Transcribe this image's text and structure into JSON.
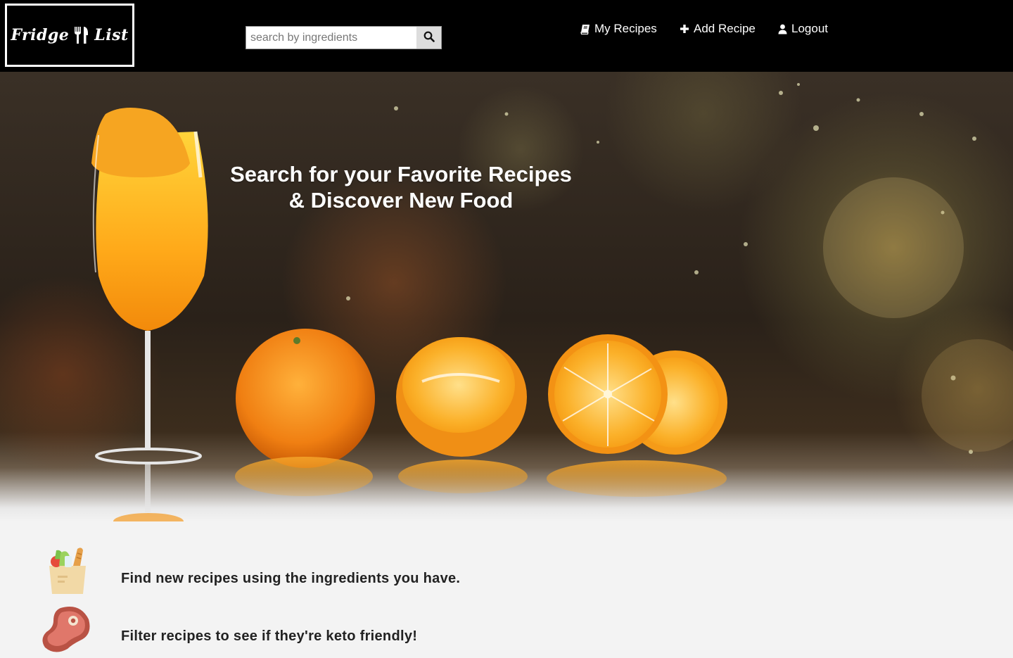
{
  "header": {
    "logo_left": "Fridge",
    "logo_right": "List",
    "logo_icon": "fork-knife-icon",
    "search": {
      "placeholder": "search by ingredients",
      "value": "",
      "button_icon": "search-icon"
    },
    "nav": [
      {
        "label": "My Recipes",
        "icon": "book-icon"
      },
      {
        "label": "Add Recipe",
        "icon": "plus-icon"
      },
      {
        "label": "Logout",
        "icon": "user-icon"
      }
    ]
  },
  "hero": {
    "title_line1": "Search for your Favorite Recipes",
    "title_line2": "& Discover New Food"
  },
  "features": [
    {
      "text": "Find new recipes using the ingredients you have.",
      "icon": "grocery-bag-icon"
    },
    {
      "text": "Filter recipes to see if they're keto friendly!",
      "icon": "meat-icon"
    }
  ],
  "colors": {
    "header_bg": "#000000",
    "page_bg": "#f3f3f3",
    "orange": "#f7941d"
  }
}
